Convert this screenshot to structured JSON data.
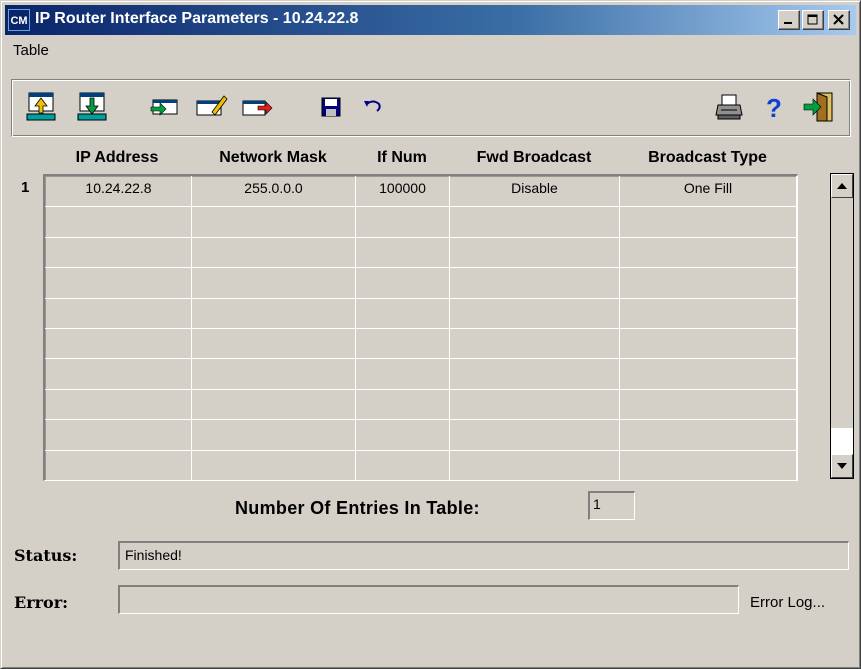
{
  "window": {
    "title": "IP Router Interface Parameters - 10.24.22.8",
    "icon_text": "CM"
  },
  "menu": {
    "items": [
      "Table"
    ]
  },
  "toolbar": {
    "buttons": [
      "upload-icon",
      "download-icon",
      "insert-row-icon",
      "edit-row-icon",
      "delete-row-icon",
      "save-icon",
      "undo-icon",
      "print-icon",
      "help-icon",
      "exit-icon"
    ]
  },
  "table": {
    "columns": [
      "IP Address",
      "Network Mask",
      "If Num",
      "Fwd Broadcast",
      "Broadcast Type"
    ],
    "row_numbers": [
      "1"
    ],
    "rows": [
      [
        "10.24.22.8",
        "255.0.0.0",
        "100000",
        "Disable",
        "One Fill"
      ],
      [
        "",
        "",
        "",
        "",
        ""
      ],
      [
        "",
        "",
        "",
        "",
        ""
      ],
      [
        "",
        "",
        "",
        "",
        ""
      ],
      [
        "",
        "",
        "",
        "",
        ""
      ],
      [
        "",
        "",
        "",
        "",
        ""
      ],
      [
        "",
        "",
        "",
        "",
        ""
      ],
      [
        "",
        "",
        "",
        "",
        ""
      ],
      [
        "",
        "",
        "",
        "",
        ""
      ],
      [
        "",
        "",
        "",
        "",
        ""
      ]
    ]
  },
  "entries": {
    "label": "Number Of Entries In Table:",
    "value": "1"
  },
  "status": {
    "label": "Status:",
    "value": "Finished!"
  },
  "error": {
    "label": "Error:",
    "value": "",
    "log_button": "Error Log..."
  }
}
